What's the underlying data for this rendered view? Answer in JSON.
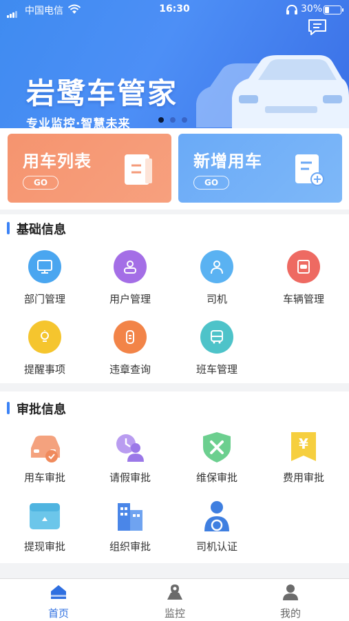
{
  "status_bar": {
    "carrier": "中国电信",
    "time": "16:30",
    "battery": "30%"
  },
  "banner": {
    "title": "岩鹭车管家",
    "subtitle": "专业监控·智慧未来",
    "active_dot": 0,
    "dot_count": 3
  },
  "quick_cards": [
    {
      "title": "用车列表",
      "go": "GO"
    },
    {
      "title": "新增用车",
      "go": "GO"
    }
  ],
  "basic_info": {
    "heading": "基础信息",
    "items": [
      {
        "label": "部门管理",
        "icon": "monitor-icon",
        "color": "#4aa6f0"
      },
      {
        "label": "用户管理",
        "icon": "user-badge-icon",
        "color": "#a46ee6"
      },
      {
        "label": "司机",
        "icon": "driver-icon",
        "color": "#5ab2f2"
      },
      {
        "label": "车辆管理",
        "icon": "vehicle-icon",
        "color": "#ee6a62"
      },
      {
        "label": "提醒事项",
        "icon": "bulb-icon",
        "color": "#f5c52e"
      },
      {
        "label": "违章查询",
        "icon": "ticket-icon",
        "color": "#f28448"
      },
      {
        "label": "班车管理",
        "icon": "bus-icon",
        "color": "#4ec3c9"
      }
    ]
  },
  "approval_info": {
    "heading": "审批信息",
    "items": [
      {
        "label": "用车审批",
        "icon": "car-approval-icon"
      },
      {
        "label": "请假审批",
        "icon": "leave-approval-icon"
      },
      {
        "label": "维保审批",
        "icon": "maintenance-approval-icon"
      },
      {
        "label": "费用审批",
        "icon": "expense-approval-icon"
      },
      {
        "label": "提现审批",
        "icon": "wallet-approval-icon"
      },
      {
        "label": "组织审批",
        "icon": "organization-approval-icon"
      },
      {
        "label": "司机认证",
        "icon": "driver-auth-icon"
      }
    ]
  },
  "tab_bar": {
    "active": 0,
    "tabs": [
      {
        "label": "首页",
        "icon": "home-icon"
      },
      {
        "label": "监控",
        "icon": "location-icon"
      },
      {
        "label": "我的",
        "icon": "profile-icon"
      }
    ]
  }
}
